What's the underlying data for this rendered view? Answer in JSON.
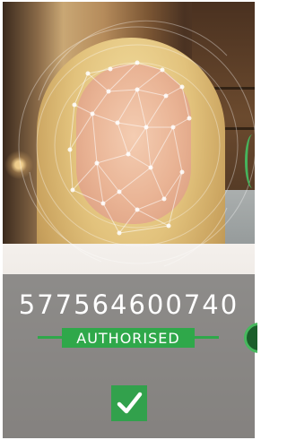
{
  "verification": {
    "id_number": "577564600740",
    "status_label": "AUTHORISED",
    "status_color": "#2fa84a",
    "confirm_icon": "checkmark-icon"
  },
  "camera": {
    "subject": "face-scan-mesh"
  }
}
